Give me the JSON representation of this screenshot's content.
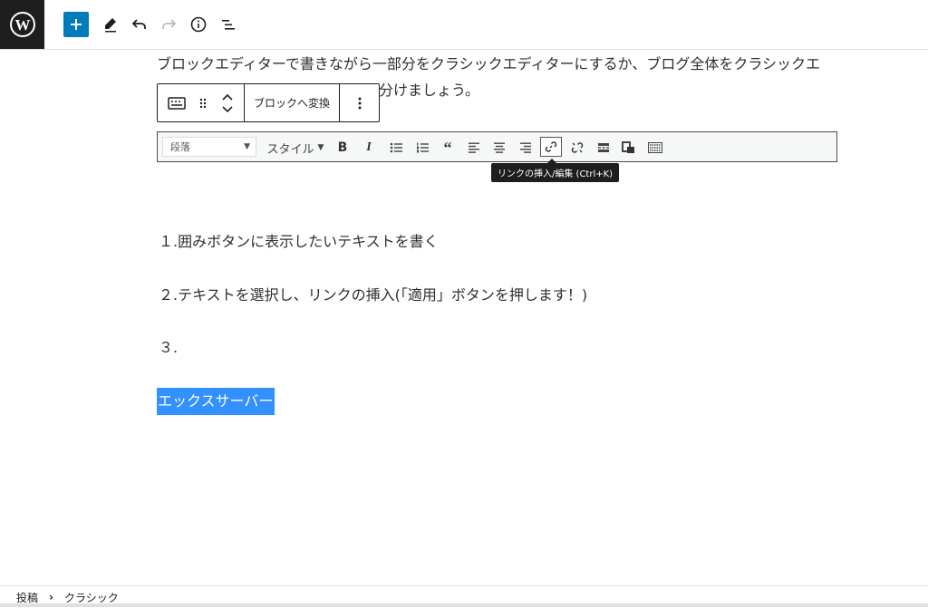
{
  "header": {
    "logo_icon": "wordpress-logo-icon",
    "tools": [
      "add-block-icon",
      "edit-pencil-icon",
      "undo-icon",
      "redo-icon",
      "info-icon",
      "list-view-icon"
    ],
    "accent_color": "#007cba"
  },
  "content": {
    "paragraph_line1": "ブロックエディターで書きながら一部分をクラシックエディターにするか、ブログ全体をクラシックエ",
    "paragraph_line2_tail": "分けましょう。",
    "step1": "１.囲みボタンに表示したいテキストを書く",
    "step2": "２.テキストを選択し、リンクの挿入(「適用」ボタンを押します！)",
    "step3": "３.",
    "selected_text": "エックスサーバー"
  },
  "block_toolbar": {
    "convert_label": "ブロックへ変換"
  },
  "classic_toolbar": {
    "format_value": "段落",
    "style_label": "スタイル",
    "bold_label": "B",
    "italic_label": "I",
    "tooltip": "リンクの挿入/編集 (Ctrl+K)"
  },
  "footer": {
    "breadcrumb_root": "投稿",
    "breadcrumb_separator": "›",
    "breadcrumb_current": "クラシック"
  },
  "colors": {
    "selection": "#3390ff",
    "dark": "#1e1e1e"
  }
}
